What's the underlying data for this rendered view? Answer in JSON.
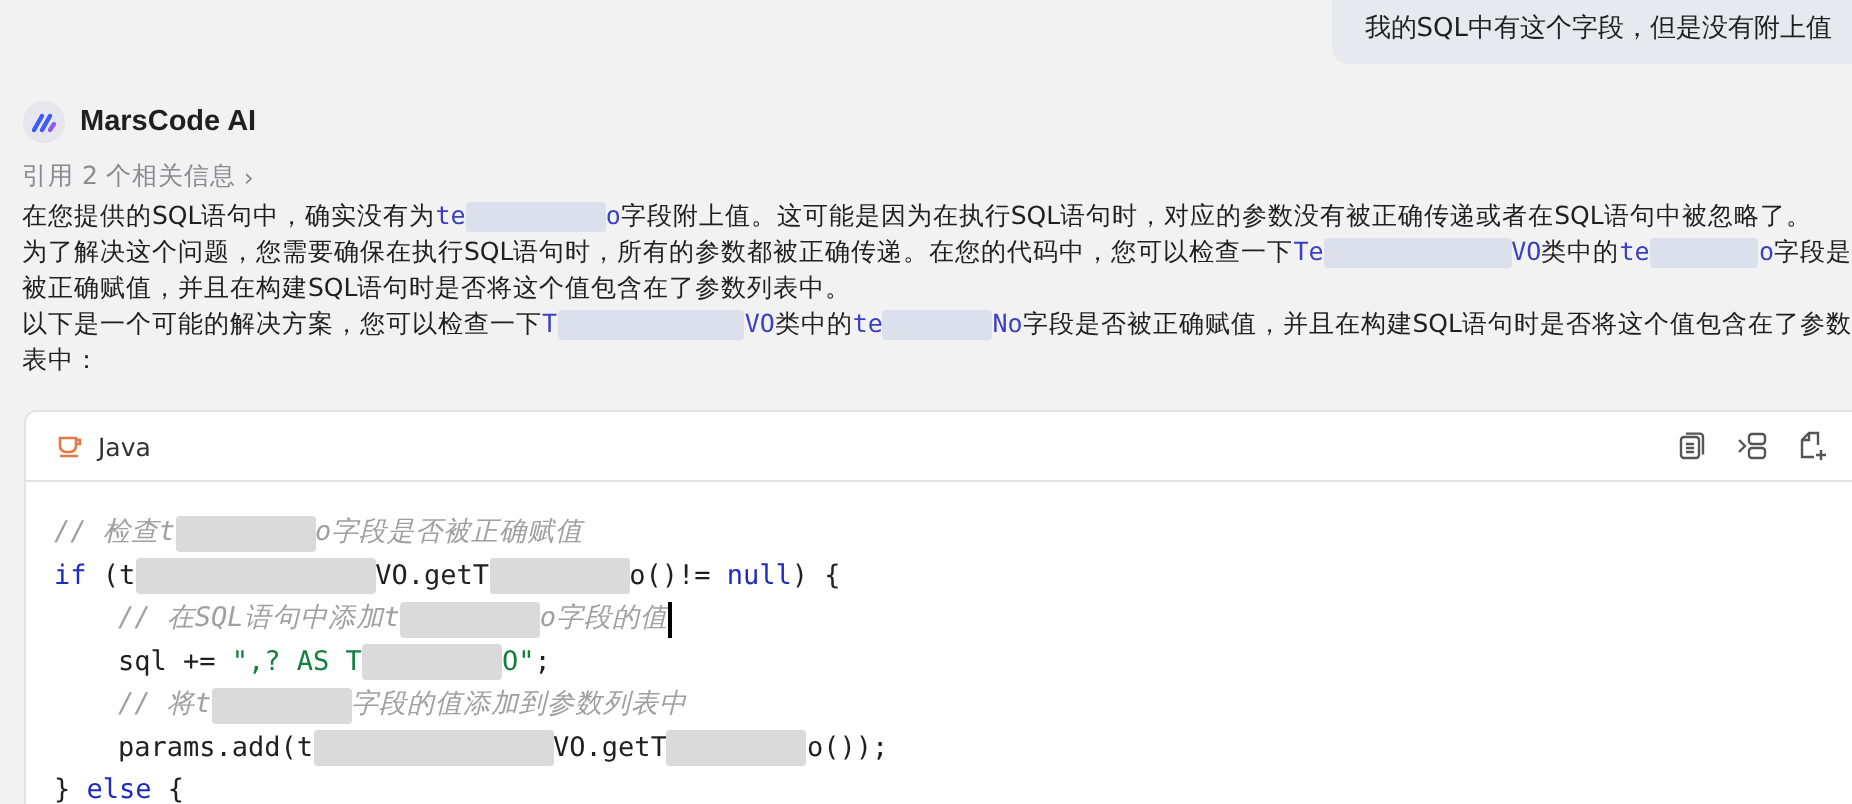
{
  "user_message": {
    "text": "我的SQL中有这个字段，但是没有附上值"
  },
  "assistant": {
    "name": "MarsCode AI",
    "references": "引用 2 个相关信息",
    "references_arrow": "›"
  },
  "answer_lines": [
    [
      {
        "kind": "text",
        "text": "在您提供的SQL语句中，确实没有为"
      },
      {
        "kind": "code",
        "text": "te"
      },
      {
        "kind": "redacted_medium"
      },
      {
        "kind": "code",
        "text": "o"
      },
      {
        "kind": "text",
        "text": "字段附上值。这可能是因为在执行SQL语句时，对应的参数没有被正确传递或者在SQL语句中被忽略了。"
      }
    ],
    [
      {
        "kind": "text",
        "text": "为了解决这个问题，您需要确保在执行SQL语句时，所有的参数都被正确传递。在您的代码中，您可以检查一下"
      },
      {
        "kind": "code",
        "text": "Te"
      },
      {
        "kind": "redacted_long"
      },
      {
        "kind": "code",
        "text": "VO"
      },
      {
        "kind": "text",
        "text": "类中的"
      },
      {
        "kind": "code",
        "text": "te"
      },
      {
        "kind": "redacted_medium"
      },
      {
        "kind": "code",
        "text": "o"
      },
      {
        "kind": "text",
        "text": "字段是"
      }
    ],
    [
      {
        "kind": "text",
        "text": "被正确赋值，并且在构建SQL语句时是否将这个值包含在了参数列表中。"
      }
    ],
    [
      {
        "kind": "text",
        "text": "以下是一个可能的解决方案，您可以检查一下"
      },
      {
        "kind": "code",
        "text": "T"
      },
      {
        "kind": "redacted_long"
      },
      {
        "kind": "code",
        "text": "VO"
      },
      {
        "kind": "text",
        "text": "类中的"
      },
      {
        "kind": "code",
        "text": "te"
      },
      {
        "kind": "redacted_medium"
      },
      {
        "kind": "code",
        "text": "No"
      },
      {
        "kind": "text",
        "text": "字段是否被正确赋值，并且在构建SQL语句时是否将这个值包含在了参数"
      }
    ],
    [
      {
        "kind": "text",
        "text": "表中："
      }
    ]
  ],
  "code_block": {
    "language": "Java",
    "lines": [
      {
        "indent": false,
        "tokens": [
          {
            "kind": "comment",
            "text": "// 检查t"
          },
          {
            "kind": "redacted_medium"
          },
          {
            "kind": "comment",
            "text": "o字段是否被正确赋值"
          }
        ]
      },
      {
        "indent": false,
        "tokens": [
          {
            "kind": "keyword",
            "text": "if"
          },
          {
            "kind": "plain",
            "text": " (t"
          },
          {
            "kind": "redacted_long"
          },
          {
            "kind": "plain",
            "text": "VO.getT"
          },
          {
            "kind": "redacted_medium"
          },
          {
            "kind": "plain",
            "text": "o()!= "
          },
          {
            "kind": "keyword",
            "text": "null"
          },
          {
            "kind": "plain",
            "text": ") {"
          }
        ]
      },
      {
        "indent": true,
        "cursor": true,
        "tokens": [
          {
            "kind": "comment",
            "text": "// 在SQL语句中添加t"
          },
          {
            "kind": "redacted_medium"
          },
          {
            "kind": "comment",
            "text": "o字段的值"
          }
        ]
      },
      {
        "indent": true,
        "tokens": [
          {
            "kind": "plain",
            "text": "sql += "
          },
          {
            "kind": "string",
            "text": "\",? AS T"
          },
          {
            "kind": "redacted_medium"
          },
          {
            "kind": "string",
            "text": "O\""
          },
          {
            "kind": "plain",
            "text": ";"
          }
        ]
      },
      {
        "indent": true,
        "tokens": [
          {
            "kind": "comment",
            "text": "// 将t"
          },
          {
            "kind": "redacted_medium"
          },
          {
            "kind": "comment",
            "text": "字段的值添加到参数列表中"
          }
        ]
      },
      {
        "indent": true,
        "tokens": [
          {
            "kind": "plain",
            "text": "params.add(t"
          },
          {
            "kind": "redacted_long"
          },
          {
            "kind": "plain",
            "text": "VO.getT"
          },
          {
            "kind": "redacted_medium"
          },
          {
            "kind": "plain",
            "text": "o());"
          }
        ]
      },
      {
        "indent": false,
        "tokens": [
          {
            "kind": "plain",
            "text": "} "
          },
          {
            "kind": "keyword",
            "text": "else"
          },
          {
            "kind": "plain",
            "text": " {"
          }
        ]
      }
    ]
  }
}
